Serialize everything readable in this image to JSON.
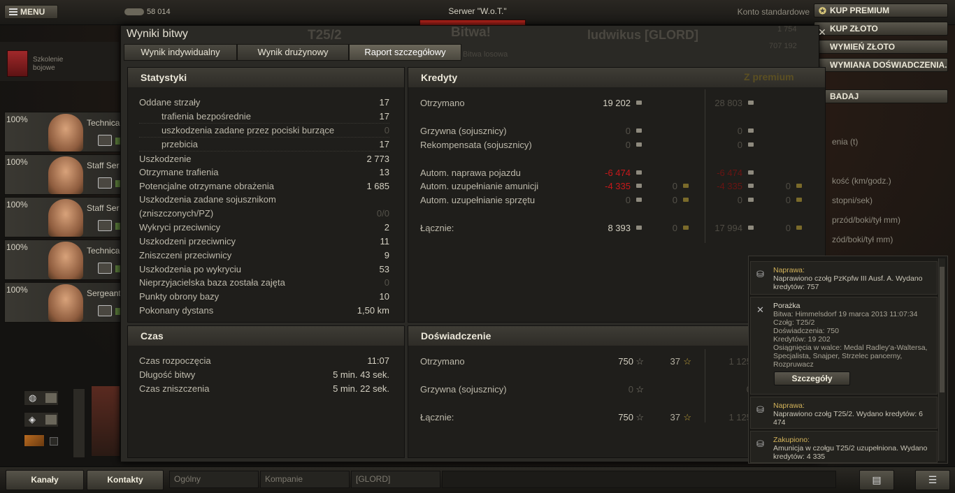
{
  "top": {
    "menu_label": "MENU",
    "gold": "58 014",
    "server": "Serwer \"W.o.T.\"",
    "account_type": "Konto standardowe",
    "buttons": [
      "KUP PREMIUM",
      "KUP ZŁOTO",
      "WYMIEŃ ZŁOTO",
      "WYMIANA DOŚWIADCZENIA..."
    ],
    "research_label": "BADAJ",
    "bg_battle": "Bitwa!",
    "bg_tank": "T25/2",
    "bg_player": "ludwikus [GLORD]",
    "bg_mode": "Bitwa losowa",
    "bg_num1": "1 754",
    "bg_num2": "707 192"
  },
  "side": {
    "training": "Szkolenie bojowe",
    "crew": [
      {
        "pct": "100%",
        "role": "Technical"
      },
      {
        "pct": "100%",
        "role": "Staff Ser"
      },
      {
        "pct": "100%",
        "role": "Staff Ser"
      },
      {
        "pct": "100%",
        "role": "Technical"
      },
      {
        "pct": "100%",
        "role": "Sergeant"
      }
    ],
    "right_labels": [
      "enia (t)",
      "kość (km/godz.)",
      "stopni/sek)",
      "przód/boki/tył mm)",
      "zód/boki/tył mm)"
    ]
  },
  "window": {
    "title": "Wyniki bitwy",
    "tabs": [
      "Wynik indywidualny",
      "Wynik drużynowy",
      "Raport szczegółowy"
    ]
  },
  "stats": {
    "header": "Statystyki",
    "rows": [
      {
        "label": "Oddane strzały",
        "value": "17",
        "sub": false
      },
      {
        "label": "trafienia bezpośrednie",
        "value": "17",
        "sub": true
      },
      {
        "label": "uszkodzenia zadane przez pociski burzące",
        "value": "0",
        "sub": true,
        "dim": true
      },
      {
        "label": "przebicia",
        "value": "17",
        "sub": true
      },
      {
        "label": "Uszkodzenie",
        "value": "2 773",
        "sub": false
      },
      {
        "label": "Otrzymane trafienia",
        "value": "13",
        "sub": false
      },
      {
        "label": "Potencjalne otrzymane obrażenia",
        "value": "1 685",
        "sub": false
      },
      {
        "label": "Uszkodzenia zadane sojusznikom",
        "value": "",
        "sub": false
      },
      {
        "label": "(zniszczonych/PZ)",
        "value": "0/0",
        "sub": false,
        "dim": true
      },
      {
        "label": "Wykryci przeciwnicy",
        "value": "2",
        "sub": false
      },
      {
        "label": "Uszkodzeni przeciwnicy",
        "value": "11",
        "sub": false
      },
      {
        "label": "Zniszczeni przeciwnicy",
        "value": "9",
        "sub": false
      },
      {
        "label": "Uszkodzenia po wykryciu",
        "value": "53",
        "sub": false
      },
      {
        "label": "Nieprzyjacielska baza została zajęta",
        "value": "0",
        "sub": false,
        "dim": true
      },
      {
        "label": "Punkty obrony bazy",
        "value": "10",
        "sub": false
      },
      {
        "label": "Pokonany dystans",
        "value": "1,50 km",
        "sub": false
      }
    ]
  },
  "time": {
    "header": "Czas",
    "rows": [
      {
        "label": "Czas rozpoczęcia",
        "value": "11:07"
      },
      {
        "label": "Długość bitwy",
        "value": "5 min. 43 sek."
      },
      {
        "label": "Czas zniszczenia",
        "value": "5 min. 22 sek."
      }
    ]
  },
  "credits": {
    "header": "Kredyty",
    "premium_header": "Z premium",
    "rows": [
      {
        "label": "Otrzymano",
        "c": "19 202",
        "g": "",
        "pc": "28 803",
        "pg": ""
      },
      {
        "label": "Grzywna (sojusznicy)",
        "c": "0",
        "g": "",
        "pc": "0",
        "pg": ""
      },
      {
        "label": "Rekompensata (sojusznicy)",
        "c": "0",
        "g": "",
        "pc": "0",
        "pg": ""
      },
      {
        "label": "Autom. naprawa pojazdu",
        "c": "-6 474",
        "g": "",
        "pc": "-6 474",
        "pg": ""
      },
      {
        "label": "Autom. uzupełnianie amunicji",
        "c": "-4 335",
        "g": "0",
        "pc": "-4 335",
        "pg": "0"
      },
      {
        "label": "Autom. uzupełnianie sprzętu",
        "c": "0",
        "g": "0",
        "pc": "0",
        "pg": "0"
      },
      {
        "label": "Łącznie:",
        "c": "8 393",
        "g": "0",
        "pc": "17 994",
        "pg": "0"
      }
    ]
  },
  "xp": {
    "header": "Doświadczenie",
    "rows": [
      {
        "label": "Otrzymano",
        "xp": "750",
        "free": "37",
        "pxp": "1 125"
      },
      {
        "label": "Grzywna (sojusznicy)",
        "xp": "0",
        "free": "",
        "pxp": "0"
      },
      {
        "label": "Łącznie:",
        "xp": "750",
        "free": "37",
        "pxp": "1 125"
      }
    ]
  },
  "notifications": [
    {
      "title": "Naprawa:",
      "body": "Naprawiono czołg PzKpfw III Ausf. A. Wydano kredytów:  757"
    },
    {
      "title": "Porażka",
      "body": "Bitwa: Himmelsdorf 19 marca 2013 11:07:34\nCzołg: T25/2\nDoświadczenia: 750\nKredytów: 19 202\nOsiągnięcia w walce: Medal Radley'a-Waltersa, Specjalista, Snajper, Strzelec pancerny, Rozpruwacz",
      "button": "Szczegóły"
    },
    {
      "title": "Naprawa:",
      "body": "Naprawiono czołg T25/2. Wydano kredytów: 6 474"
    },
    {
      "title": "Zakupiono:",
      "body": "Amunicja w czołgu T25/2 uzupełniona. Wydano kredytów:  4 335"
    }
  ],
  "bottom": {
    "channels": "Kanały",
    "contacts": "Kontakty",
    "chat_tabs": [
      "Ogólny",
      "Kompanie",
      "[GLORD]"
    ]
  },
  "colors": {
    "negative": "#c8181a",
    "premium": "#5b4f22",
    "accent_gold": "#d3b35a"
  }
}
